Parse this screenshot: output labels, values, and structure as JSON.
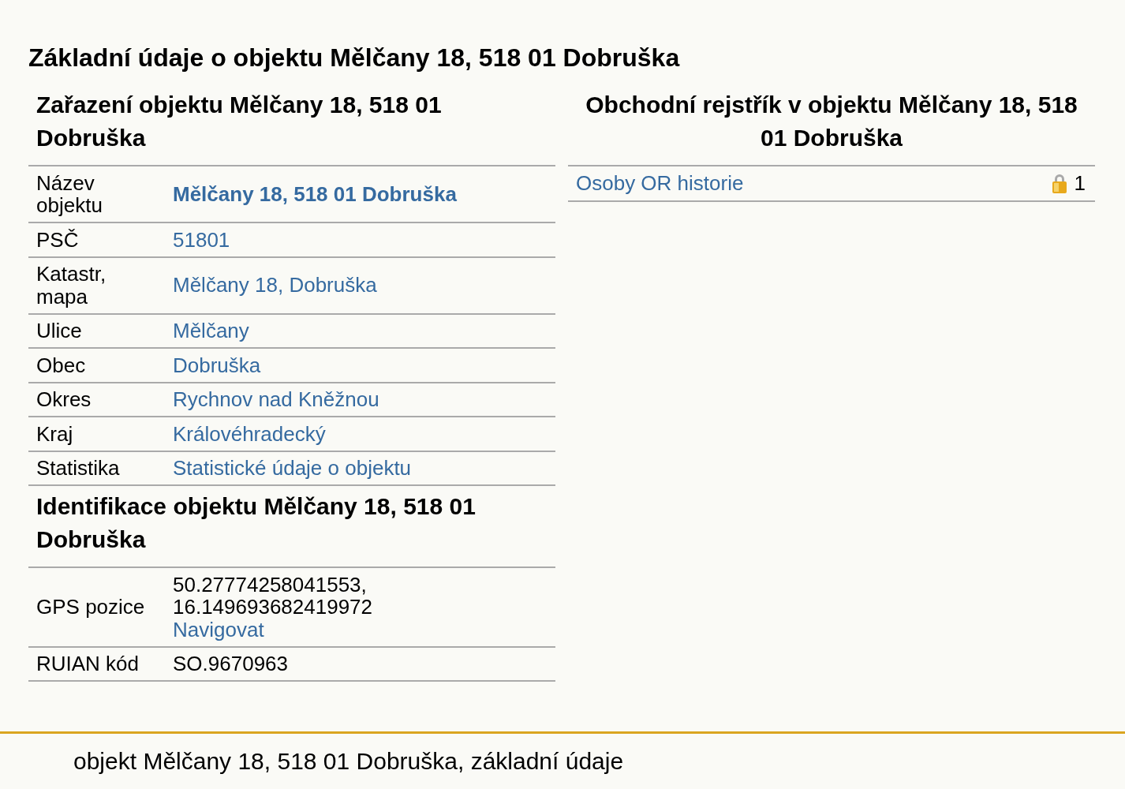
{
  "page_title": "Základní údaje o objektu Mělčany 18, 518 01 Dobruška",
  "classification": {
    "heading": "Zařazení objektu Mělčany 18, 518 01 Dobruška",
    "rows": [
      {
        "label": "Název objektu",
        "value": "Mělčany 18, 518 01 Dobruška",
        "kind": "primary_link"
      },
      {
        "label": "PSČ",
        "value": "51801",
        "kind": "link"
      },
      {
        "label": "Katastr, mapa",
        "value": "Mělčany 18, Dobruška",
        "kind": "link"
      },
      {
        "label": "Ulice",
        "value": "Mělčany",
        "kind": "link"
      },
      {
        "label": "Obec",
        "value": "Dobruška",
        "kind": "link"
      },
      {
        "label": "Okres",
        "value": "Rychnov nad Kněžnou",
        "kind": "link"
      },
      {
        "label": "Kraj",
        "value": "Královéhradecký",
        "kind": "link"
      },
      {
        "label": "Statistika",
        "value": "Statistické údaje o objektu",
        "kind": "link"
      }
    ]
  },
  "identification": {
    "heading": "Identifikace objektu Mělčany 18, 518 01 Dobruška",
    "rows": [
      {
        "label": "GPS pozice",
        "lines": [
          "50.27774258041553,",
          "16.149693682419972"
        ],
        "link": "Navigovat",
        "kind": "coordinates"
      },
      {
        "label": "RUIAN kód",
        "value": "SO.9670963",
        "kind": "text"
      }
    ]
  },
  "business_register": {
    "heading": "Obchodní rejstřík v objektu Mělčany 18, 518 01 Dobruška",
    "rows": [
      {
        "label": "Osoby OR historie",
        "count": "1",
        "locked": true
      }
    ]
  },
  "footer": {
    "text": "objekt Mělčany 18, 518 01 Dobruška, základní údaje"
  }
}
